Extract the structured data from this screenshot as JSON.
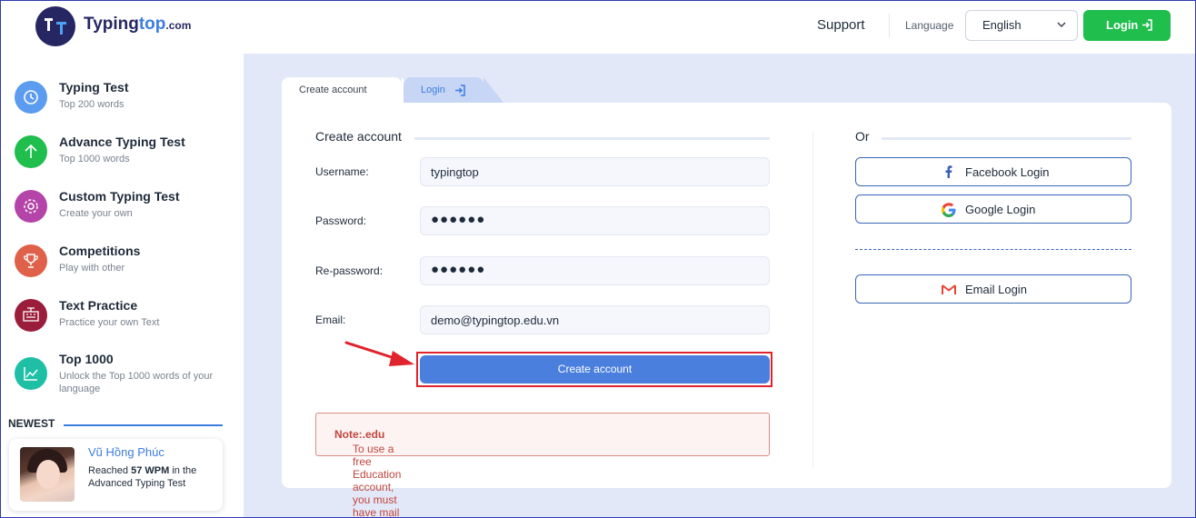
{
  "header": {
    "logo_main": "Typing",
    "logo_accent": "top",
    "logo_domain": ".com",
    "support": "Support",
    "language_label": "Language",
    "language_value": "English",
    "login_button": "Login"
  },
  "sidebar": {
    "items": [
      {
        "title": "Typing Test",
        "subtitle": "Top 200 words",
        "icon": "clock-icon",
        "color": "#5b9bf0"
      },
      {
        "title": "Advance Typing Test",
        "subtitle": "Top 1000 words",
        "icon": "arrow-up-icon",
        "color": "#1fbe4d"
      },
      {
        "title": "Custom Typing Test",
        "subtitle": "Create your own",
        "icon": "gear-icon",
        "color": "#b444a8"
      },
      {
        "title": "Competitions",
        "subtitle": "Play with other",
        "icon": "trophy-icon",
        "color": "#e0614a"
      },
      {
        "title": "Text Practice",
        "subtitle": "Practice your own Text",
        "icon": "keyboard-text-icon",
        "color": "#9a1d3b"
      },
      {
        "title": "Top 1000",
        "subtitle": "Unlock the Top 1000 words of your language",
        "icon": "chart-line-icon",
        "color": "#1fbfa6"
      }
    ],
    "newest_label": "NEWEST",
    "newest": {
      "name": "Vũ Hồng Phúc",
      "text_before": "Reached ",
      "wpm": "57 WPM",
      "text_after": " in the Advanced Typing Test"
    }
  },
  "tabs": {
    "create": "Create account",
    "login": "Login"
  },
  "form": {
    "heading": "Create account",
    "username_label": "Username:",
    "username_value": "typingtop",
    "password_label": "Password:",
    "password_value": "●●●●●●",
    "repassword_label": "Re-password:",
    "repassword_value": "●●●●●●",
    "email_label": "Email:",
    "email_value": "demo@typingtop.edu.vn",
    "submit": "Create account",
    "note_prefix": "Note:",
    "note_text": " To use a free Education account, you must have mail ",
    "note_suffix": ".edu"
  },
  "social": {
    "or_label": "Or",
    "facebook": "Facebook Login",
    "google": "Google Login",
    "email": "Email Login"
  },
  "colors": {
    "brand_dark": "#262663",
    "accent_blue": "#3c7ee0",
    "primary_green": "#1fbe4d",
    "submit_blue": "#4a7fdd",
    "highlight_red": "#e0232d",
    "page_bg": "#e2e8f8"
  }
}
